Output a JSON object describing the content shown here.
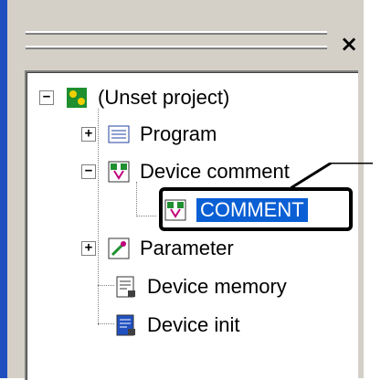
{
  "panel": {
    "close_glyph": "×"
  },
  "tree": {
    "root": {
      "label": "(Unset project)",
      "icon": "project-icon",
      "expanded": true
    },
    "items": [
      {
        "label": "Program",
        "icon": "program-icon",
        "expander": "+"
      },
      {
        "label": "Device comment",
        "icon": "device-comment-icon",
        "expander": "−"
      },
      {
        "label": "COMMENT",
        "icon": "comment-icon",
        "selected": true
      },
      {
        "label": "Parameter",
        "icon": "parameter-icon",
        "expander": "+"
      },
      {
        "label": "Device memory",
        "icon": "device-memory-icon"
      },
      {
        "label": "Device init",
        "icon": "device-init-icon"
      }
    ]
  },
  "colors": {
    "selection": "#0a5fd4",
    "frame_blue": "#1f4fbf",
    "panel_gray": "#d4d0c8"
  }
}
